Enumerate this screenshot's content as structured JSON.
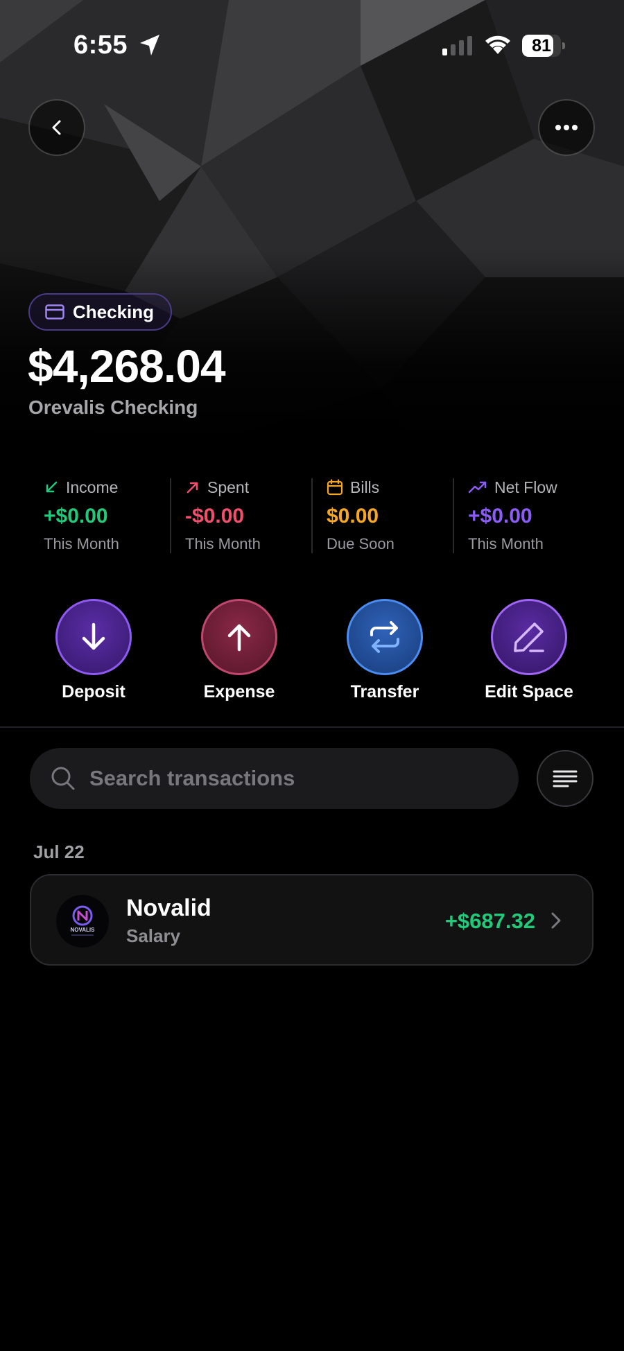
{
  "status_bar": {
    "time": "6:55",
    "battery": "81"
  },
  "account": {
    "type_label": "Checking",
    "balance": "$4,268.04",
    "name": "Orevalis Checking"
  },
  "stats": [
    {
      "label": "Income",
      "value": "+$0.00",
      "sub": "This Month",
      "color": "#22c97a",
      "icon": "arrow-down-left-icon"
    },
    {
      "label": "Spent",
      "value": "-$0.00",
      "sub": "This Month",
      "color": "#f0506e",
      "icon": "arrow-up-right-icon"
    },
    {
      "label": "Bills",
      "value": "$0.00",
      "sub": "Due Soon",
      "color": "#f5a623",
      "icon": "calendar-icon"
    },
    {
      "label": "Net Flow",
      "value": "+$0.00",
      "sub": "This Month",
      "color": "#8b5cf6",
      "icon": "trending-up-icon"
    }
  ],
  "actions": [
    {
      "label": "Deposit",
      "icon": "arrow-down-icon"
    },
    {
      "label": "Expense",
      "icon": "arrow-up-icon"
    },
    {
      "label": "Transfer",
      "icon": "transfer-icon"
    },
    {
      "label": "Edit Space",
      "icon": "pencil-icon"
    }
  ],
  "search": {
    "placeholder": "Search transactions"
  },
  "transactions": {
    "groups": [
      {
        "date": "Jul 22",
        "items": [
          {
            "name": "Novalid",
            "category": "Salary",
            "amount": "+$687.32",
            "amount_color": "#22c97a",
            "logo_text": "NOVALIS"
          }
        ]
      }
    ]
  }
}
